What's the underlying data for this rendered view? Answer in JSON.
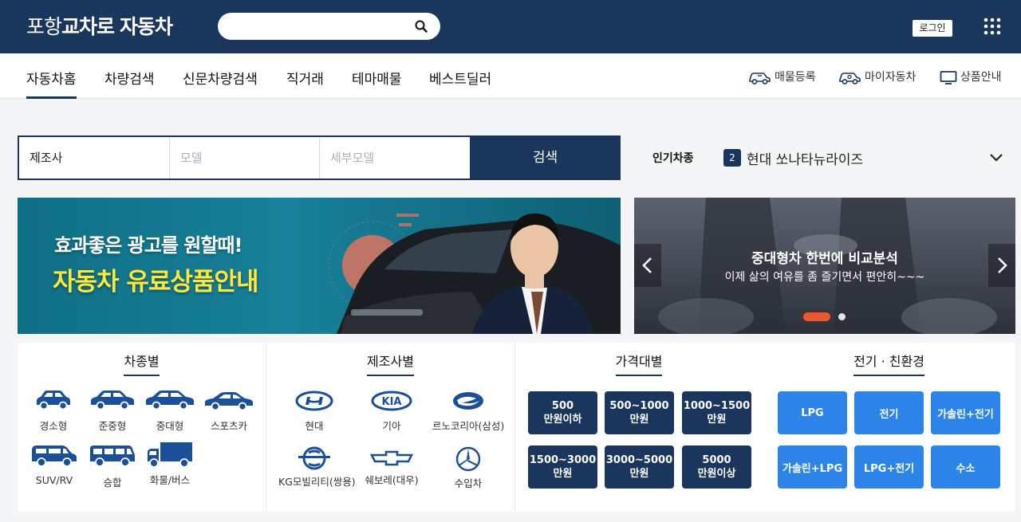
{
  "header": {
    "logo_light": "포항",
    "logo_bold": "교차로",
    "logo_tail": "자동차",
    "search_placeholder": "",
    "search_icon": "search-icon",
    "login_label": "로그인",
    "menu_icon": "grid-menu-icon"
  },
  "nav": {
    "items": [
      "자동차홈",
      "차량검색",
      "신문차량검색",
      "직거래",
      "테마매물",
      "베스트딜러"
    ],
    "active": "자동차홈",
    "right": [
      {
        "label": "매물등록",
        "icon": "car-register-icon"
      },
      {
        "label": "마이자동차",
        "icon": "my-car-icon"
      },
      {
        "label": "상품안내",
        "icon": "monitor-icon"
      }
    ]
  },
  "search_filter": {
    "maker": "제조사",
    "model_placeholder": "모델",
    "detail_placeholder": "세부모델",
    "button": "검색"
  },
  "popular": {
    "label": "인기차종",
    "rank": "2",
    "name": "현대 쏘나타뉴라이즈"
  },
  "banner_left": {
    "line1": "효과좋은 광고를 원할때!",
    "line2": "자동차 유료상품안내"
  },
  "banner_right": {
    "title": "중대형차 한번에 비교분석",
    "subtitle": "이제 삶의 여유를 좀 즐기면서 편안히~~~",
    "slide_count": 2,
    "active_slide": 1
  },
  "categories": {
    "body_type": {
      "title": "차종별",
      "items": [
        "경소형",
        "준중형",
        "중대형",
        "스포츠카",
        "SUV/RV",
        "승합",
        "화물/버스"
      ]
    },
    "manufacturer": {
      "title": "제조사별",
      "items": [
        "현대",
        "기아",
        "르노코리아(삼성)",
        "KG모빌리티(쌍용)",
        "쉐보레(대우)",
        "수입차"
      ]
    },
    "price": {
      "title": "가격대별",
      "items": [
        "500\n만원이하",
        "500~1000\n만원",
        "1000~1500\n만원",
        "1500~3000\n만원",
        "3000~5000\n만원",
        "5000\n만원이상"
      ]
    },
    "eco": {
      "title": "전기 · 친환경",
      "items": [
        "LPG",
        "전기",
        "가솔린+전기",
        "가솔린+LPG",
        "LPG+전기",
        "수소"
      ]
    }
  },
  "colors": {
    "navy": "#1b365d",
    "blue": "#2c84e8",
    "accent_orange": "#f0562b",
    "banner_yellow": "#ffe83a"
  }
}
